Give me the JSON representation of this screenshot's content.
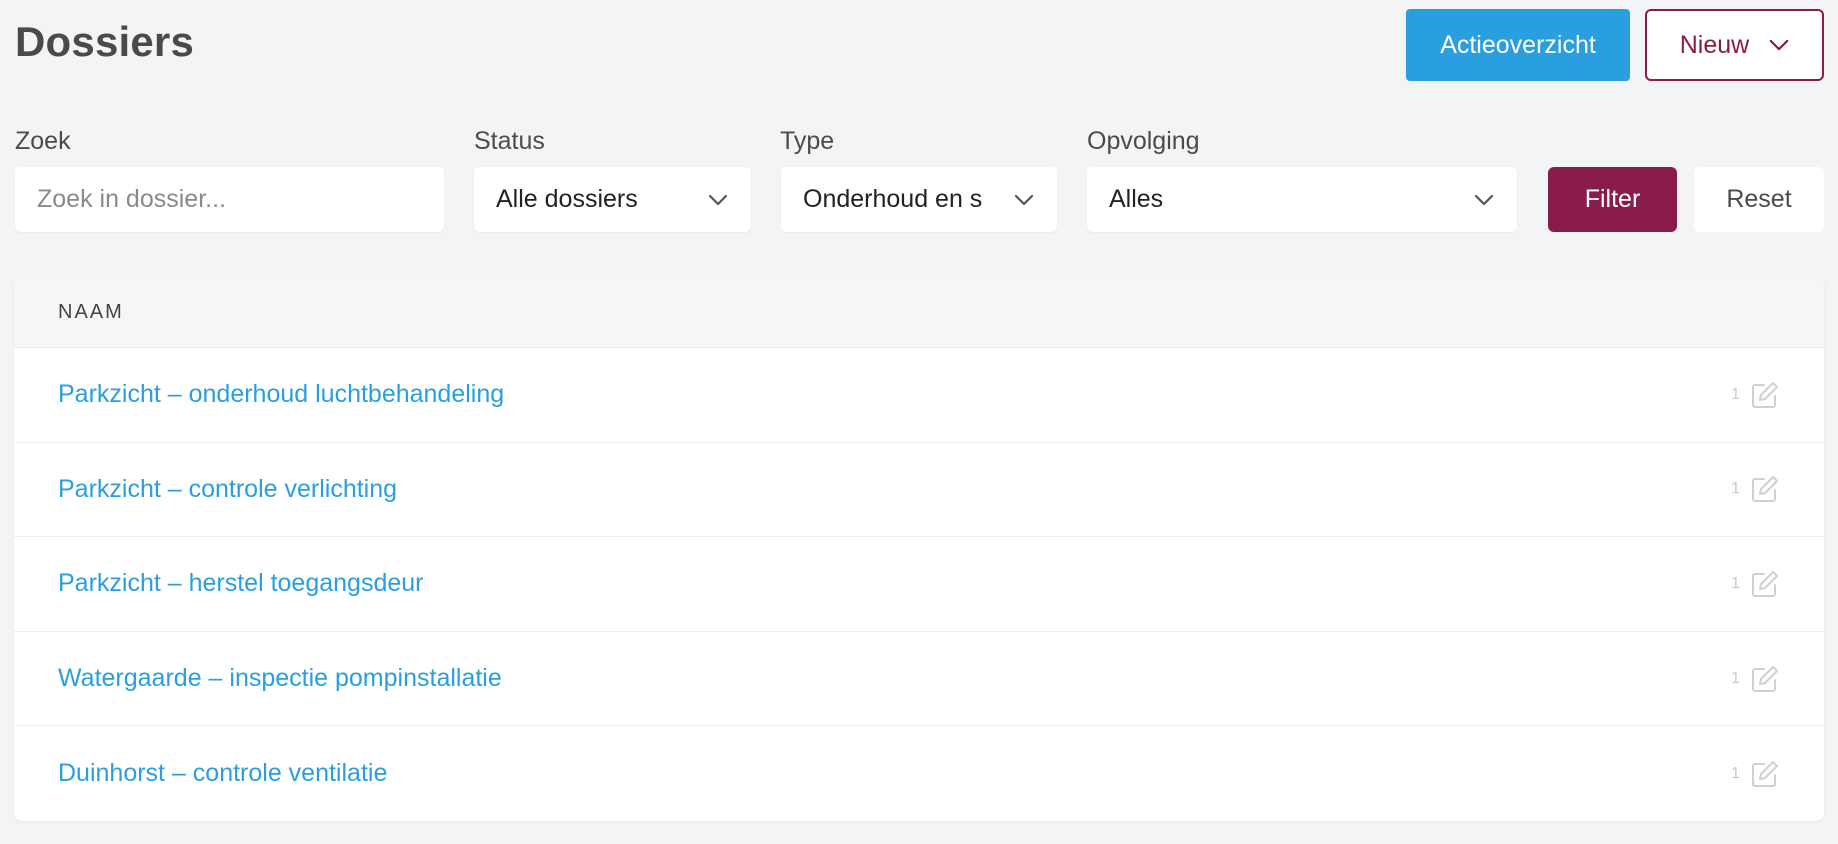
{
  "header": {
    "title": "Dossiers",
    "actie_button": "Actieoverzicht",
    "nieuw_button": "Nieuw"
  },
  "filters": {
    "search_label": "Zoek",
    "search_placeholder": "Zoek in dossier...",
    "status_label": "Status",
    "status_value": "Alle dossiers",
    "type_label": "Type",
    "type_value": "Onderhoud en s",
    "opvolging_label": "Opvolging",
    "opvolging_value": "Alles",
    "filter_button": "Filter",
    "reset_button": "Reset"
  },
  "table": {
    "column_header": "NAAM",
    "rows": [
      {
        "name": "Parkzicht – onderhoud luchtbehandeling",
        "count": "1"
      },
      {
        "name": "Parkzicht – controle verlichting",
        "count": "1"
      },
      {
        "name": "Parkzicht – herstel toegangsdeur",
        "count": "1"
      },
      {
        "name": "Watergaarde – inspectie pompinstallatie",
        "count": "1"
      },
      {
        "name": "Duinhorst – controle ventilatie",
        "count": "1"
      }
    ]
  },
  "icons": {
    "chevron": "chevron-down-icon",
    "edit": "edit-icon"
  },
  "colors": {
    "primary_blue": "#2a9fdf",
    "brand_burgundy": "#8a1c4b",
    "background": "#f3f4f6"
  }
}
